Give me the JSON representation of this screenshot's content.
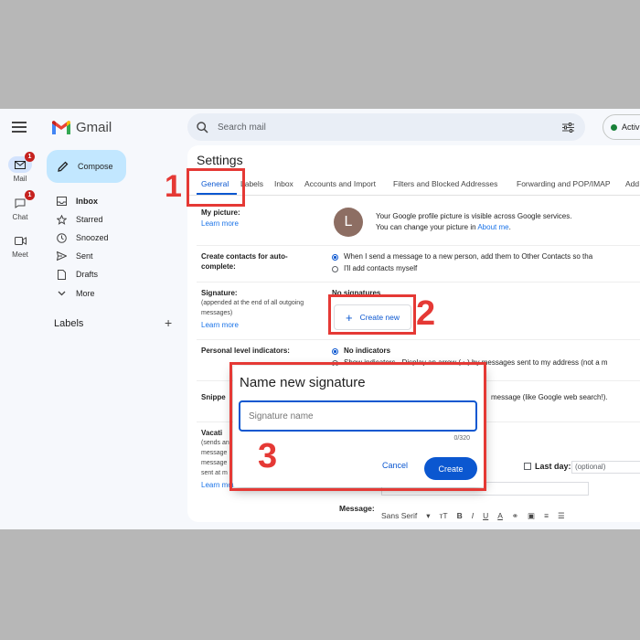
{
  "app": {
    "name": "Gmail"
  },
  "rail": {
    "items": [
      {
        "label": "Mail",
        "badge": "1",
        "icon": "mail-icon"
      },
      {
        "label": "Chat",
        "badge": "1",
        "icon": "chat-icon"
      },
      {
        "label": "Meet",
        "badge": "",
        "icon": "video-icon"
      }
    ]
  },
  "compose": {
    "label": "Compose"
  },
  "nav": {
    "items": [
      {
        "label": "Inbox",
        "icon": "inbox-icon"
      },
      {
        "label": "Starred",
        "icon": "star-icon"
      },
      {
        "label": "Snoozed",
        "icon": "clock-icon"
      },
      {
        "label": "Sent",
        "icon": "send-icon"
      },
      {
        "label": "Drafts",
        "icon": "draft-icon"
      },
      {
        "label": "More",
        "icon": "chevron-down-icon"
      }
    ],
    "labels_heading": "Labels"
  },
  "search": {
    "placeholder": "Search mail"
  },
  "status": {
    "label": "Activ"
  },
  "settings": {
    "title": "Settings",
    "tabs": [
      "General",
      "Labels",
      "Inbox",
      "Accounts and Import",
      "Filters and Blocked Addresses",
      "Forwarding and POP/IMAP",
      "Add"
    ],
    "picture": {
      "label": "My picture:",
      "link": "Learn more",
      "avatar_letter": "L",
      "line1": "Your Google profile picture is visible across Google services.",
      "line2_prefix": "You can change your picture in ",
      "line2_link": "About me",
      "line2_suffix": "."
    },
    "contacts": {
      "label": "Create contacts for auto-complete:",
      "option1": "When I send a message to a new person, add them to Other Contacts so tha",
      "option2": "I'll add contacts myself"
    },
    "signature": {
      "label": "Signature:",
      "sub": "(appended at the end of all outgoing messages)",
      "link": "Learn more",
      "none_text": "No signatures",
      "create_new": "Create new"
    },
    "personal": {
      "label": "Personal level indicators:",
      "option1": "No indicators",
      "option2": "Show indicators - Display an arrow ( › ) by messages sent to my address (not a m"
    },
    "snippets": {
      "label": "Snippe",
      "value": "message (like Google web search!)."
    },
    "vacation": {
      "label": "Vacati",
      "sub": "(sends an",
      "sub2": "message",
      "sub3": "message",
      "sub4": "sent at m",
      "link": "Learn more",
      "last_day_label": "Last day:",
      "last_day_placeholder": "(optional)",
      "message_label": "Message:"
    },
    "toolbar": {
      "font": "Sans Serif",
      "size_glyph": "тT",
      "bold": "B",
      "italic": "I",
      "underline": "U",
      "color": "A"
    }
  },
  "dialog": {
    "title": "Name new signature",
    "input_placeholder": "Signature name",
    "count": "0/320",
    "cancel": "Cancel",
    "create": "Create"
  },
  "annotations": {
    "step1": "1",
    "step2": "2",
    "step3": "3",
    "color": "#e53935"
  }
}
